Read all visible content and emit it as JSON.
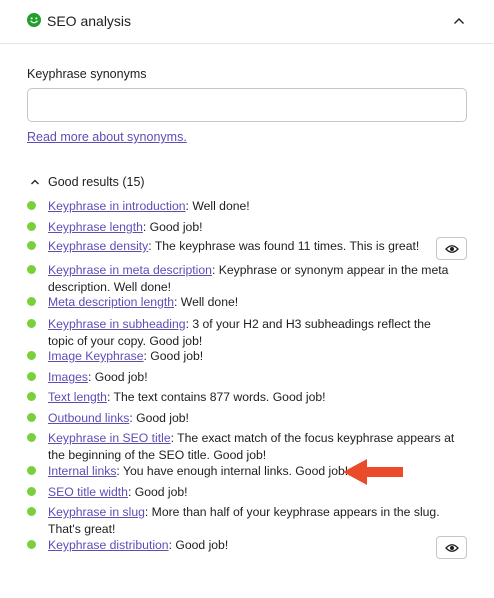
{
  "header": {
    "title": "SEO analysis",
    "status_color": "#1ea02b"
  },
  "synonyms": {
    "label": "Keyphrase synonyms",
    "value": "",
    "link": "Read more about synonyms."
  },
  "good_results": {
    "heading": "Good results (15)",
    "items": [
      {
        "link": "Keyphrase in introduction",
        "text": ": Well done!"
      },
      {
        "link": "Keyphrase length",
        "text": ": Good job!"
      },
      {
        "link": "Keyphrase density",
        "text": ": The keyphrase was found 11 times. This is great!",
        "has_eye": true
      },
      {
        "link": "Keyphrase in meta description",
        "text": ": Keyphrase or synonym appear in the meta description. Well done!"
      },
      {
        "link": "Meta description length",
        "text": ": Well done!"
      },
      {
        "link": "Keyphrase in subheading",
        "text": ": 3 of your H2 and H3 subheadings reflect the topic of your copy. Good job!"
      },
      {
        "link": "Image Keyphrase",
        "text": ": Good job!"
      },
      {
        "link": "Images",
        "text": ": Good job!"
      },
      {
        "link": "Text length",
        "text": ": The text contains 877 words. Good job!"
      },
      {
        "link": "Outbound links",
        "text": ": Good job!"
      },
      {
        "link": "Keyphrase in SEO title",
        "text": ": The exact match of the focus keyphrase appears at the beginning of the SEO title. Good job!"
      },
      {
        "link": "Internal links",
        "text": ": You have enough internal links. Good job!"
      },
      {
        "link": "SEO title width",
        "text": ": Good job!"
      },
      {
        "link": "Keyphrase in slug",
        "text": ": More than half of your keyphrase appears in the slug. That's great!"
      },
      {
        "link": "Keyphrase distribution",
        "text": ": Good job!",
        "has_eye": true
      }
    ]
  },
  "colors": {
    "good": "#7ad03a",
    "link": "#5b4fb6",
    "annotation_arrow": "#e94b2b"
  }
}
